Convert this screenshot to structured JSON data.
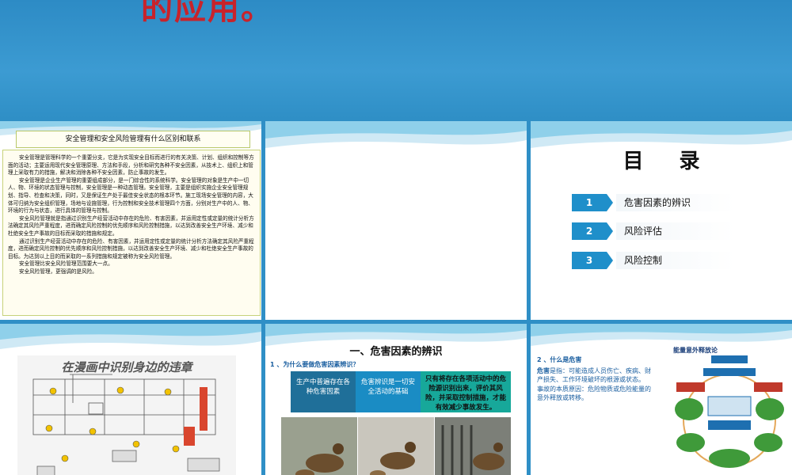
{
  "banner": {
    "title": "的应用。"
  },
  "slide1": {
    "title": "安全管理和安全风险管理有什么区别和联系",
    "paragraphs": [
      "安全管理是管理科学的一个重要分支，它是为实现安全目标而进行的有关决策、计划、组织和控制等方面的活动；主要运用现代安全管理原理、方法和手段，分析和研究各种不安全因素，从技术上、组织上和管理上采取有力的措施，解决和消除各种不安全因素，防止事故的发生。",
      "安全管理是企业生产管理的重要组成部分，是一门综合性的系统科学。安全管理的对象是生产中一切人、物、环境的状态管理与控制，安全管理是一种动态管理。安全管理，主要是组织实施企业安全管理规划、指导、检查和决策，同时，又是保证生产处于最佳安全状态的根本环节。施工现场安全管理的内容，大体可归纳为安全组织管理，场地与设施管理，行为控制和安全技术管理四个方面，分别对生产中的人、物、环境的行为与状态，进行具体的管理与控制。",
      "安全风险管理就是指通过识别生产经营活动中存在的危险、有害因素，并运用定性或定量的统计分析方法确定其风险严重程度，进而确定风险控制的优先顺序和风险控制措施，以达到改善安全生产环境、减少和杜绝安全生产事故的目标而采取的措施和规定。",
      "通过识别生产经营活动中存在的危险、有害因素，并运用定性或定量的统计分析方法确定其风险严重程度，进而确定风险控制的优先顺序和风险控制措施，以达到改善安全生产环境、减少和杜绝安全生产事故的目标。为达到以上目的而采取的一系列措施和规定被称为安全风险管理。",
      "安全管理比安全风险管理范围要大一点。",
      "安全风险管理，更强调的是风险。"
    ]
  },
  "slide3": {
    "title": "目 录",
    "items": [
      {
        "num": "1",
        "label": "危害因素的辨识"
      },
      {
        "num": "2",
        "label": "风险评估"
      },
      {
        "num": "3",
        "label": "风险控制"
      }
    ]
  },
  "slide4": {
    "cartoon_title": "在漫画中识别身边的违章"
  },
  "slide5": {
    "title": "一、危害因素的辨识",
    "subtitle": "1 、为什么要做危害因素辨识？",
    "boxes": [
      {
        "text": "生产中普遍存在各种危害因素",
        "color": "#1f6f99"
      },
      {
        "text": "危害辨识是一切安全活动的基础",
        "color": "#1a8cc4"
      },
      {
        "text": "只有将存在各项活动中的危险源识别出来，评价其风险，并采取控制措施，才能有效减少事故发生。",
        "color": "#17a89a"
      }
    ]
  },
  "slide6": {
    "heading": "2 、什么是危害",
    "def_label": "危害",
    "def_text": "是指：可能造成人员伤亡、疾病、财产损失、工作环境破坏的根源或状态。",
    "essence": "事故的本质原因：危险物质或危险能量的意外释放或转移。",
    "diagram_title": "能量意外释放论"
  }
}
